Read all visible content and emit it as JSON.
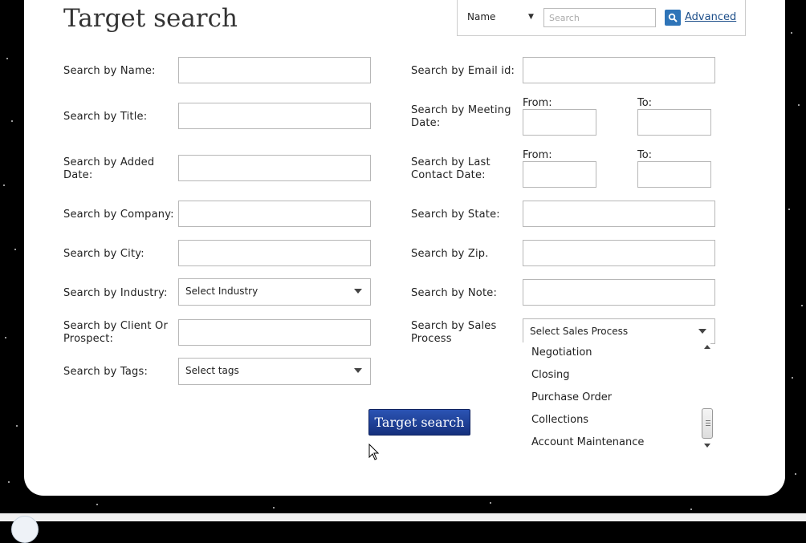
{
  "page": {
    "title": "Target search"
  },
  "quick_search": {
    "field_value": "Name",
    "placeholder": "Search",
    "advanced_label": "Advanced"
  },
  "left_fields": {
    "name_label": "Search by Name:",
    "title_label": "Search by Title:",
    "added_date_label": "Search by Added Date:",
    "company_label": "Search by Company:",
    "city_label": "Search by City:",
    "industry_label": "Search by Industry:",
    "industry_value": "Select Industry",
    "client_label": "Search by Client Or Prospect:",
    "tags_label": "Search by Tags:",
    "tags_value": "Select tags"
  },
  "right_fields": {
    "email_label": "Search by Email id:",
    "meeting_label": "Search by Meeting Date:",
    "last_contact_label": "Search by Last Contact Date:",
    "from_label": "From:",
    "to_label": "To:",
    "state_label": "Search by State:",
    "zip_label": "Search by Zip.",
    "note_label": "Search by Note:",
    "sales_label": "Search by Sales Process",
    "sales_value": "Select Sales Process"
  },
  "sales_options": [
    "Negotiation",
    "Closing",
    "Purchase Order",
    "Collections",
    "Account Maintenance"
  ],
  "submit_label": "Target search",
  "colors": {
    "button": "#1e3e99",
    "link": "#1d4e89",
    "search_button": "#2e74b8"
  }
}
